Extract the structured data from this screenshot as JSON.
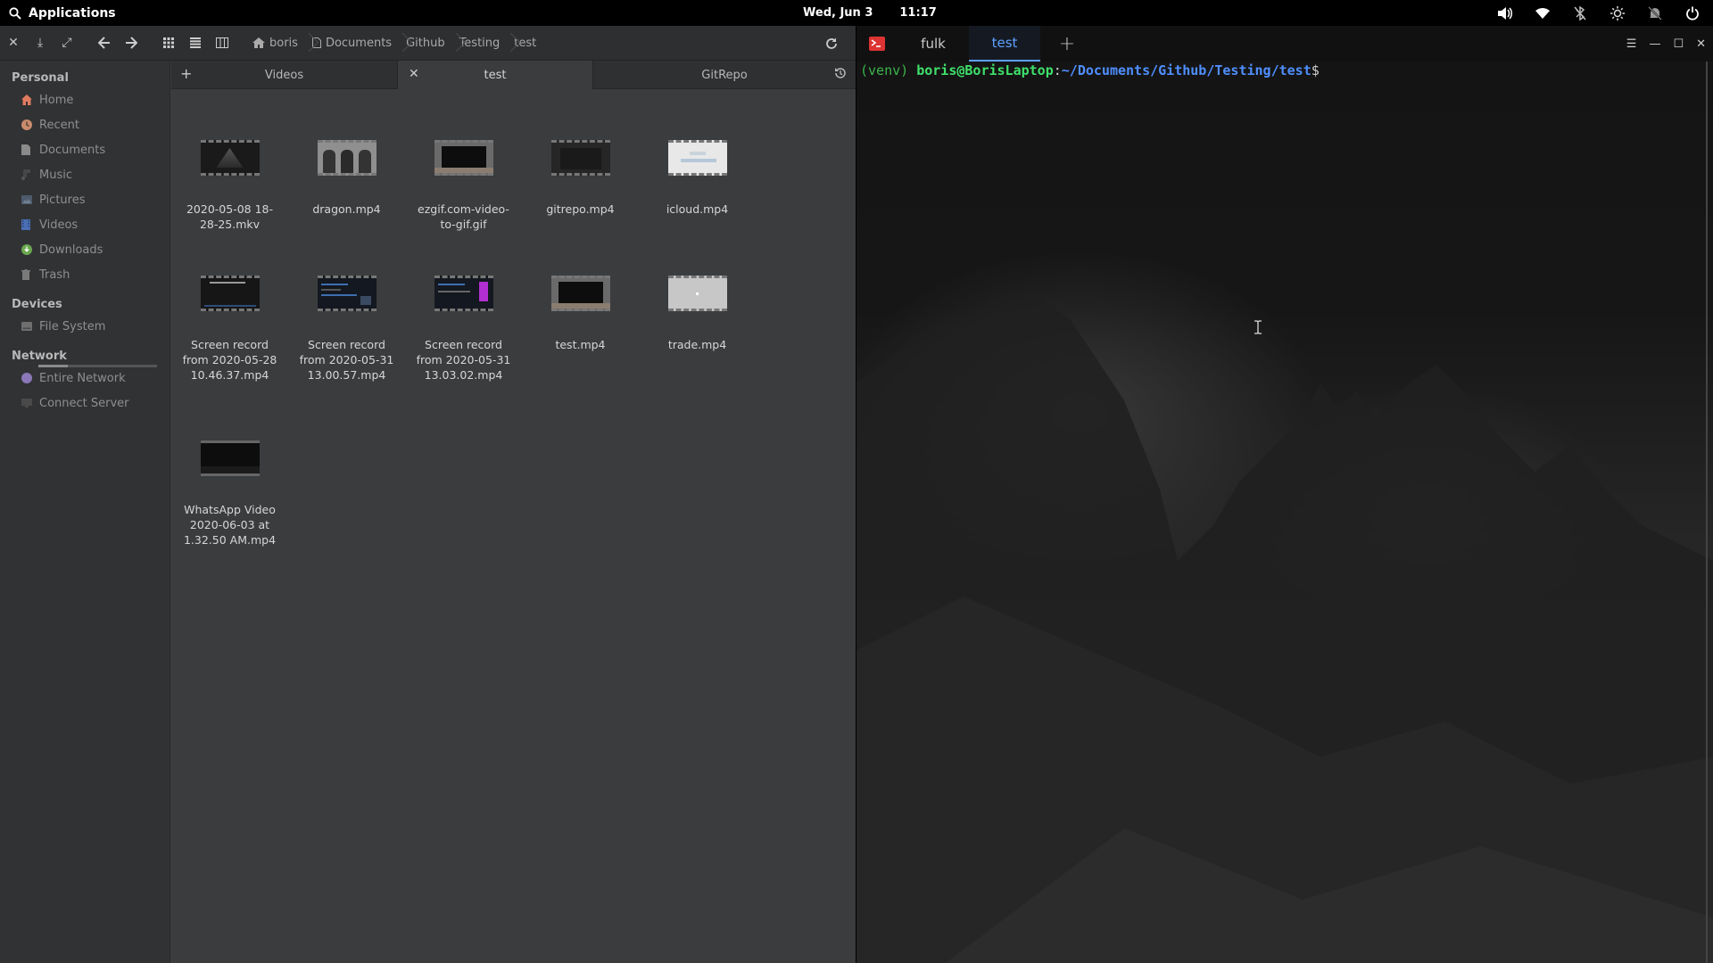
{
  "top_panel": {
    "apps_label": "Applications",
    "date": "Wed, Jun 3",
    "time": "11:17",
    "tray_icons": [
      "volume-icon",
      "wifi-icon",
      "bluetooth-off-icon",
      "brightness-icon",
      "notifications-off-icon",
      "power-icon"
    ]
  },
  "file_manager": {
    "toolbar_icons": [
      "close-icon",
      "download-icon",
      "fullscreen-icon",
      "back-icon",
      "forward-icon",
      "icon-view-icon",
      "list-view-icon",
      "column-view-icon"
    ],
    "breadcrumb": [
      "boris",
      "Documents",
      "Github",
      "Testing",
      "test"
    ],
    "sidebar": {
      "personal_label": "Personal",
      "personal_items": [
        "Home",
        "Recent",
        "Documents",
        "Music",
        "Pictures",
        "Videos",
        "Downloads",
        "Trash"
      ],
      "devices_label": "Devices",
      "devices_items": [
        "File System"
      ],
      "file_system_usage": 0.25,
      "network_label": "Network",
      "network_items": [
        "Entire Network",
        "Connect Server"
      ]
    },
    "tabs": [
      "Videos",
      "test",
      "GitRepo"
    ],
    "active_tab": "test",
    "files": [
      {
        "name": "2020-05-08 18-28-25.mkv"
      },
      {
        "name": "dragon.mp4"
      },
      {
        "name": "ezgif.com-video-to-gif.gif"
      },
      {
        "name": "gitrepo.mp4"
      },
      {
        "name": "icloud.mp4"
      },
      {
        "name": "Screen record from 2020-05-28 10.46.37.mp4"
      },
      {
        "name": "Screen record from 2020-05-31 13.00.57.mp4"
      },
      {
        "name": "Screen record from 2020-05-31 13.03.02.mp4"
      },
      {
        "name": "test.mp4"
      },
      {
        "name": "trade.mp4"
      },
      {
        "name": "WhatsApp Video 2020-06-03 at 1.32.50 AM.mp4"
      }
    ]
  },
  "terminal": {
    "tabs": [
      "fulk",
      "test"
    ],
    "active_tab": "test",
    "prompt": {
      "venv": "(venv) ",
      "user_host": "boris@BorisLaptop",
      "colon": ":",
      "path": "~/Documents/Github/Testing/test",
      "dollar": "$"
    },
    "accent_color": "#5ea0ff"
  }
}
